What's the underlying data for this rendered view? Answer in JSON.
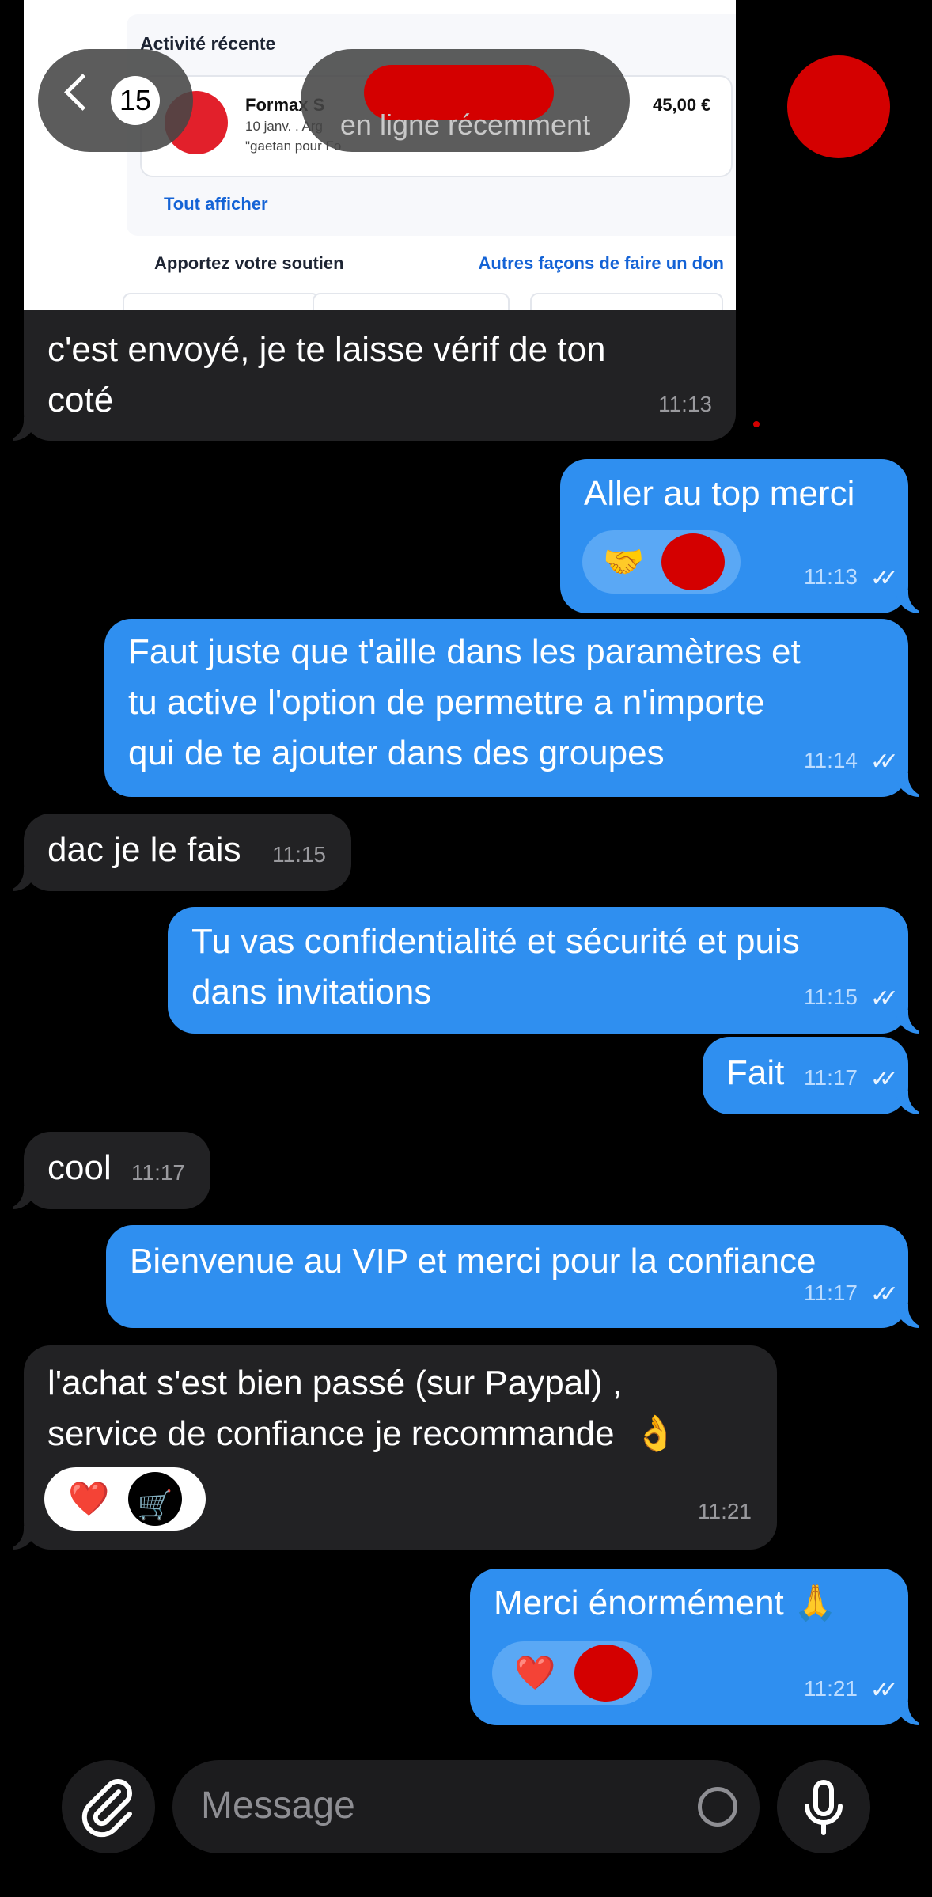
{
  "screenshot": {
    "recent_title": "Activité récente",
    "item_name": "Formax S",
    "item_date": "10 janv. . Arg",
    "item_note": "\"gaetan pour Fo",
    "item_amount": "45,00 €",
    "show_all": "Tout afficher",
    "support_title": "Apportez votre soutien",
    "other_ways": "Autres façons de faire un don"
  },
  "header": {
    "back_count": "15",
    "status": "en ligne récemment"
  },
  "messages": [
    {
      "text": "c'est envoyé, je te laisse vérif de ton\ncoté",
      "time": "11:13"
    },
    {
      "text": "Aller au top merci",
      "time": "11:13",
      "ticks": "✓✓",
      "reaction": "🤝"
    },
    {
      "text": "Faut juste que t'aille dans les paramètres et\ntu active l'option de permettre a n'importe\nqui de te ajouter dans des groupes",
      "time": "11:14",
      "ticks": "✓✓"
    },
    {
      "text": "dac je le fais",
      "time": "11:15"
    },
    {
      "text": "Tu vas confidentialité et sécurité et puis\ndans invitations",
      "time": "11:15",
      "ticks": "✓✓"
    },
    {
      "text": "Fait",
      "time": "11:17",
      "ticks": "✓✓"
    },
    {
      "text": "cool",
      "time": "11:17"
    },
    {
      "text": "Bienvenue au VIP et merci pour la confiance",
      "time": "11:17",
      "ticks": "✓✓"
    },
    {
      "text": "l'achat s'est bien passé (sur Paypal) ,\nservice de confiance je recommande  👌",
      "time": "11:21",
      "reaction": "❤️",
      "reaction2": "🛒"
    },
    {
      "text": "Merci énormément 🙏",
      "time": "11:21",
      "ticks": "✓✓",
      "reaction": "❤️"
    }
  ],
  "input": {
    "placeholder": "Message"
  }
}
